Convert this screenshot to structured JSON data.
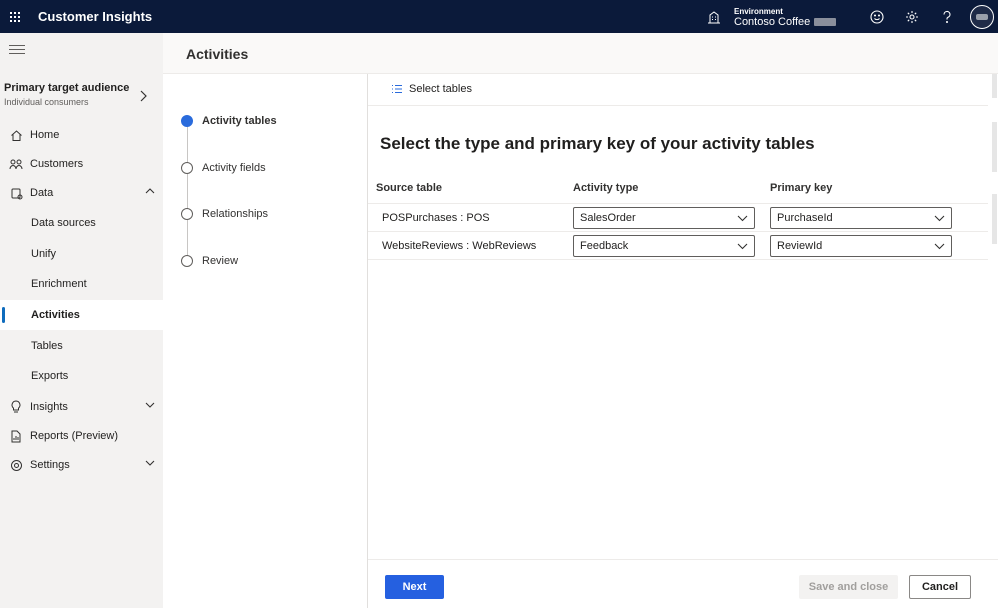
{
  "topbar": {
    "app_title": "Customer Insights",
    "environment_label": "Environment",
    "environment_value": "Contoso Coffee"
  },
  "nav": {
    "audience_title": "Primary target audience",
    "audience_subtitle": "Individual consumers",
    "items": [
      {
        "label": "Home"
      },
      {
        "label": "Customers"
      },
      {
        "label": "Data"
      },
      {
        "label": "Data sources"
      },
      {
        "label": "Unify"
      },
      {
        "label": "Enrichment"
      },
      {
        "label": "Activities"
      },
      {
        "label": "Tables"
      },
      {
        "label": "Exports"
      },
      {
        "label": "Insights"
      },
      {
        "label": "Reports (Preview)"
      },
      {
        "label": "Settings"
      }
    ]
  },
  "header": {
    "title": "Activities"
  },
  "steps": [
    {
      "label": "Activity tables"
    },
    {
      "label": "Activity fields"
    },
    {
      "label": "Relationships"
    },
    {
      "label": "Review"
    }
  ],
  "toolbar": {
    "select_tables": "Select tables"
  },
  "main": {
    "title": "Select the type and primary key of your activity tables",
    "columns": [
      "Source table",
      "Activity type",
      "Primary key"
    ],
    "rows": [
      {
        "source": "POSPurchases : POS",
        "activity_type": "SalesOrder",
        "primary_key": "PurchaseId"
      },
      {
        "source": "WebsiteReviews : WebReviews",
        "activity_type": "Feedback",
        "primary_key": "ReviewId"
      }
    ]
  },
  "footer": {
    "next": "Next",
    "save_close": "Save and close",
    "cancel": "Cancel"
  }
}
